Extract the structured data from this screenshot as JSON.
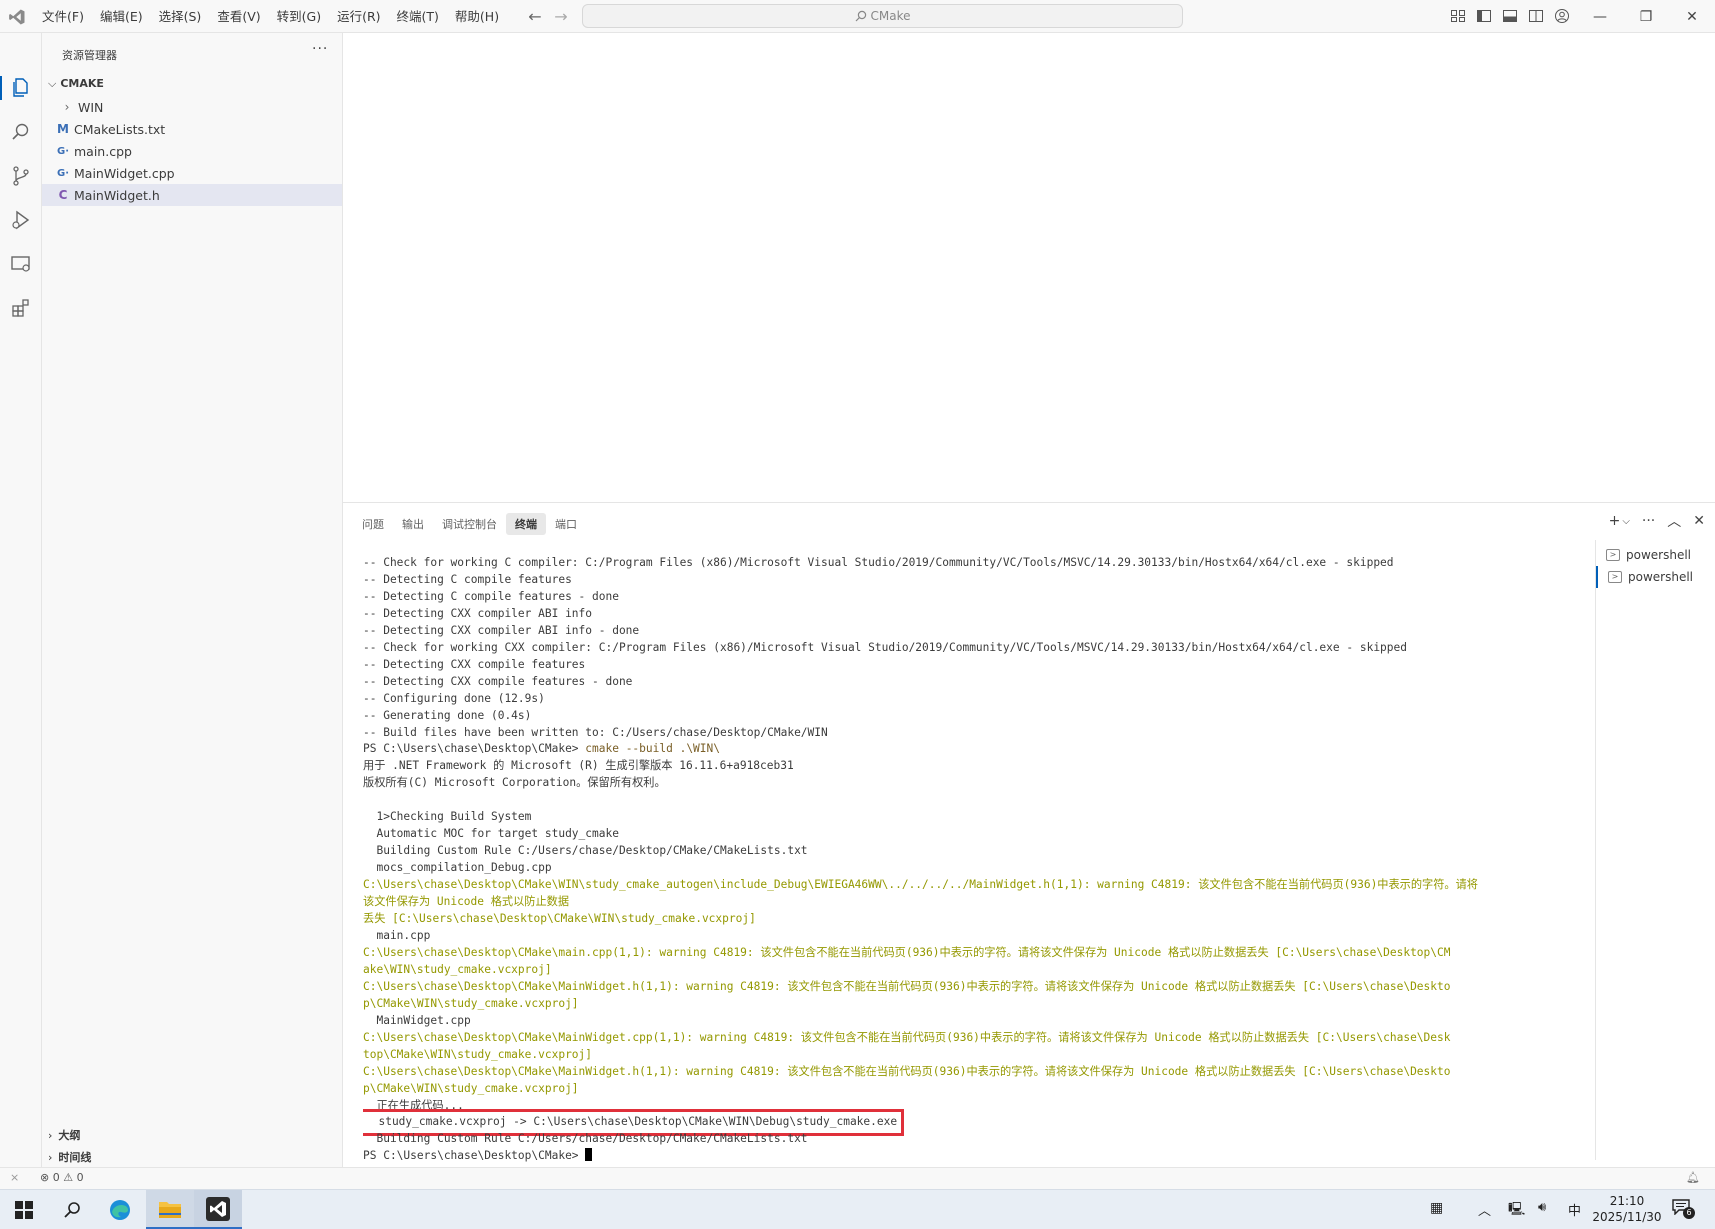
{
  "titlebar": {
    "menu": [
      "文件(F)",
      "编辑(E)",
      "选择(S)",
      "查看(V)",
      "转到(G)",
      "运行(R)",
      "终端(T)",
      "帮助(H)"
    ],
    "search": "CMake"
  },
  "sidebar": {
    "title": "资源管理器",
    "more": "···",
    "root": "CMAKE",
    "items": [
      {
        "label": "WIN",
        "icon": "chevron-right",
        "badge": "›"
      },
      {
        "label": "CMakeLists.txt",
        "icon": "cmake-file-icon",
        "badge": "M"
      },
      {
        "label": "main.cpp",
        "icon": "cpp-file-icon",
        "badge": "G·"
      },
      {
        "label": "MainWidget.cpp",
        "icon": "cpp-file-icon",
        "badge": "G·"
      },
      {
        "label": "MainWidget.h",
        "icon": "header-file-icon",
        "badge": "C"
      }
    ],
    "outline": "大纲",
    "timeline": "时间线"
  },
  "panel": {
    "tabs": [
      "问题",
      "输出",
      "调试控制台",
      "终端",
      "端口"
    ],
    "active_tab": "终端",
    "terminals": [
      "powershell",
      "powershell"
    ],
    "lines": [
      {
        "t": "-- Check for working C compiler: C:/Program Files (x86)/Microsoft Visual Studio/2019/Community/VC/Tools/MSVC/14.29.30133/bin/Hostx64/x64/cl.exe - skipped",
        "c": ""
      },
      {
        "t": "-- Detecting C compile features",
        "c": ""
      },
      {
        "t": "-- Detecting C compile features - done",
        "c": ""
      },
      {
        "t": "-- Detecting CXX compiler ABI info",
        "c": ""
      },
      {
        "t": "-- Detecting CXX compiler ABI info - done",
        "c": ""
      },
      {
        "t": "-- Check for working CXX compiler: C:/Program Files (x86)/Microsoft Visual Studio/2019/Community/VC/Tools/MSVC/14.29.30133/bin/Hostx64/x64/cl.exe - skipped",
        "c": ""
      },
      {
        "t": "-- Detecting CXX compile features",
        "c": ""
      },
      {
        "t": "-- Detecting CXX compile features - done",
        "c": ""
      },
      {
        "t": "-- Configuring done (12.9s)",
        "c": ""
      },
      {
        "t": "-- Generating done (0.4s)",
        "c": ""
      },
      {
        "t": "-- Build files have been written to: C:/Users/chase/Desktop/CMake/WIN",
        "c": ""
      },
      {
        "t": "PS C:\\Users\\chase\\Desktop\\CMake> cmake --build .\\WIN\\",
        "c": "prompt"
      },
      {
        "t": "用于 .NET Framework 的 Microsoft (R) 生成引擎版本 16.11.6+a918ceb31",
        "c": ""
      },
      {
        "t": "版权所有(C) Microsoft Corporation。保留所有权利。",
        "c": ""
      },
      {
        "t": "",
        "c": ""
      },
      {
        "t": "  1>Checking Build System",
        "c": ""
      },
      {
        "t": "  Automatic MOC for target study_cmake",
        "c": ""
      },
      {
        "t": "  Building Custom Rule C:/Users/chase/Desktop/CMake/CMakeLists.txt",
        "c": ""
      },
      {
        "t": "  mocs_compilation_Debug.cpp",
        "c": ""
      },
      {
        "t": "C:\\Users\\chase\\Desktop\\CMake\\WIN\\study_cmake_autogen\\include_Debug\\EWIEGA46WW\\../../../../MainWidget.h(1,1): warning C4819: 该文件包含不能在当前代码页(936)中表示的字符。请将",
        "c": "warn"
      },
      {
        "t": "该文件保存为 Unicode 格式以防止数据",
        "c": "warn"
      },
      {
        "t": "丢失 [C:\\Users\\chase\\Desktop\\CMake\\WIN\\study_cmake.vcxproj]",
        "c": "warn"
      },
      {
        "t": "  main.cpp",
        "c": ""
      },
      {
        "t": "C:\\Users\\chase\\Desktop\\CMake\\main.cpp(1,1): warning C4819: 该文件包含不能在当前代码页(936)中表示的字符。请将该文件保存为 Unicode 格式以防止数据丢失 [C:\\Users\\chase\\Desktop\\CM",
        "c": "warn"
      },
      {
        "t": "ake\\WIN\\study_cmake.vcxproj]",
        "c": "warn"
      },
      {
        "t": "C:\\Users\\chase\\Desktop\\CMake\\MainWidget.h(1,1): warning C4819: 该文件包含不能在当前代码页(936)中表示的字符。请将该文件保存为 Unicode 格式以防止数据丢失 [C:\\Users\\chase\\Deskto",
        "c": "warn"
      },
      {
        "t": "p\\CMake\\WIN\\study_cmake.vcxproj]",
        "c": "warn"
      },
      {
        "t": "  MainWidget.cpp",
        "c": ""
      },
      {
        "t": "C:\\Users\\chase\\Desktop\\CMake\\MainWidget.cpp(1,1): warning C4819: 该文件包含不能在当前代码页(936)中表示的字符。请将该文件保存为 Unicode 格式以防止数据丢失 [C:\\Users\\chase\\Desk",
        "c": "warn"
      },
      {
        "t": "top\\CMake\\WIN\\study_cmake.vcxproj]",
        "c": "warn"
      },
      {
        "t": "C:\\Users\\chase\\Desktop\\CMake\\MainWidget.h(1,1): warning C4819: 该文件包含不能在当前代码页(936)中表示的字符。请将该文件保存为 Unicode 格式以防止数据丢失 [C:\\Users\\chase\\Deskto",
        "c": "warn"
      },
      {
        "t": "p\\CMake\\WIN\\study_cmake.vcxproj]",
        "c": "warn"
      },
      {
        "t": "  正在生成代码...",
        "c": ""
      },
      {
        "t": "  study_cmake.vcxproj -> C:\\Users\\chase\\Desktop\\CMake\\WIN\\Debug\\study_cmake.exe",
        "c": "highlight"
      },
      {
        "t": "  Building Custom Rule C:/Users/chase/Desktop/CMake/CMakeLists.txt",
        "c": ""
      },
      {
        "t": "PS C:\\Users\\chase\\Desktop\\CMake> ",
        "c": "cursor"
      }
    ]
  },
  "statusbar": {
    "errors": "0",
    "warnings": "0"
  },
  "taskbar": {
    "ime": "中",
    "time": "21:10",
    "date": "2025/11/30",
    "notifications": "6"
  },
  "colors": {
    "accent": "#005fb8",
    "warning_text": "#949800",
    "highlight_box": "#e0303a"
  }
}
